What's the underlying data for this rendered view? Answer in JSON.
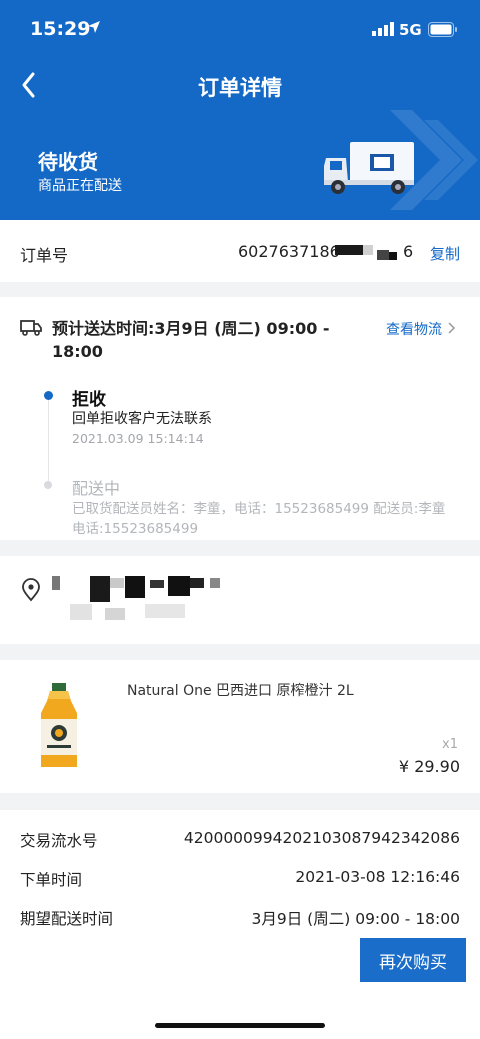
{
  "status_bar": {
    "time": "15:29",
    "network": "5G"
  },
  "nav": {
    "title": "订单详情"
  },
  "order_status": {
    "title": "待收货",
    "subtitle": "商品正在配送"
  },
  "order": {
    "label": "订单号",
    "number_visible": "6027637186",
    "number_suffix": "6",
    "copy_label": "复制"
  },
  "tracking": {
    "eta": "预计送达时间:3月9日 (周二) 09:00 - 18:00",
    "link_label": "查看物流",
    "events": [
      {
        "title": "拒收",
        "description": "回单拒收客户无法联系",
        "time": "2021.03.09 15:14:14"
      },
      {
        "title": "配送中",
        "description": "已取货配送员姓名：李童，电话：15523685499 配送员:李童 电话:15523685499"
      }
    ]
  },
  "product": {
    "name": "Natural One 巴西进口 原榨橙汁 2L",
    "quantity": "x1",
    "price": "¥ 29.90"
  },
  "info": {
    "rows": [
      {
        "label": "交易流水号",
        "value": "4200000994202103087942342086"
      },
      {
        "label": "下单时间",
        "value": "2021-03-08 12:16:46"
      },
      {
        "label": "期望配送时间",
        "value": "3月9日 (周二) 09:00 - 18:00"
      }
    ],
    "rebuy_label": "再次购买"
  },
  "colors": {
    "brand_blue": "#1469c7",
    "link_blue": "#1469c7",
    "dot_active": "#1469c7",
    "dot_inactive": "#d8dadd"
  }
}
